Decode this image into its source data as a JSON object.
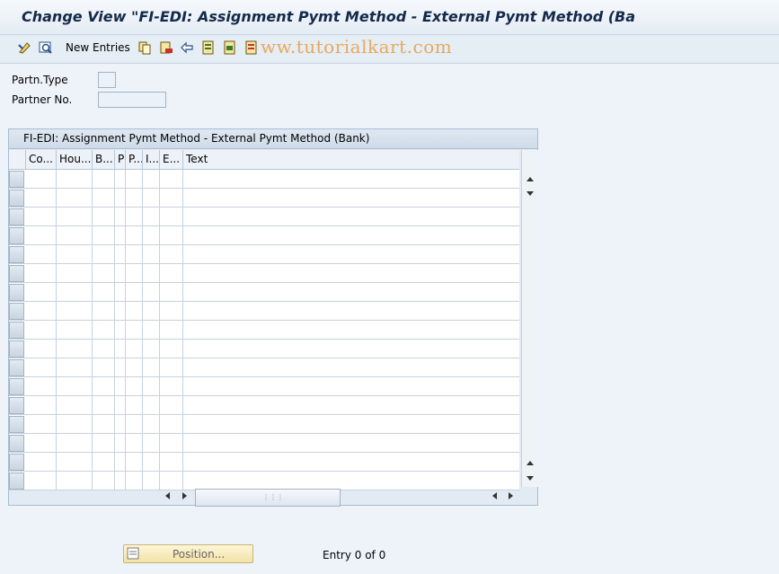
{
  "window": {
    "title": "Change View \"FI-EDI: Assignment Pymt Method - External Pymt Method (Ba"
  },
  "toolbar": {
    "new_entries_label": "New Entries",
    "icons": [
      "display-change-icon",
      "other-view-icon",
      "copy-icon",
      "delete-icon",
      "undo-icon",
      "select-all-icon",
      "select-block-icon",
      "deselect-all-icon"
    ]
  },
  "watermark": "ww.tutorialkart.com",
  "form": {
    "partner_type_label": "Partn.Type",
    "partner_type_value": "",
    "partner_no_label": "Partner No.",
    "partner_no_value": ""
  },
  "table": {
    "title": "FI-EDI: Assignment Pymt Method - External Pymt Method (Bank)",
    "columns": [
      "Co...",
      "Hou...",
      "B...",
      "P",
      "P...",
      "I...",
      "E...",
      "Text"
    ],
    "row_count": 17
  },
  "footer": {
    "position_button_label": "Position...",
    "entry_text": "Entry 0 of 0"
  },
  "colors": {
    "accent": "#142a4a",
    "button": "#f3e3a6",
    "background": "#eef3f9"
  }
}
